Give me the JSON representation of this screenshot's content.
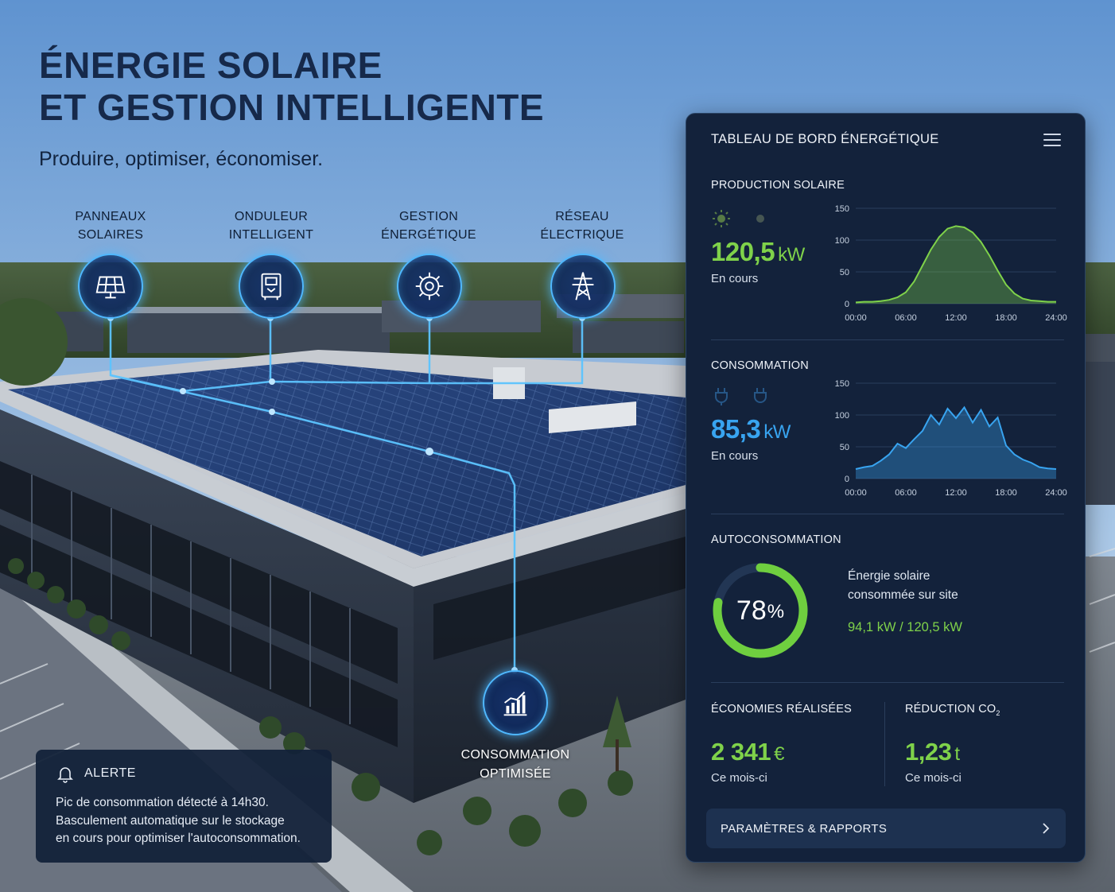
{
  "hero": {
    "title_line1": "ÉNERGIE SOLAIRE",
    "title_line2": "ET GESTION INTELLIGENTE",
    "subtitle": "Produire, optimiser, économiser."
  },
  "nodes": [
    {
      "line1": "PANNEAUX",
      "line2": "SOLAIRES",
      "icon": "solar-panel-icon"
    },
    {
      "line1": "ONDULEUR",
      "line2": "INTELLIGENT",
      "icon": "inverter-icon"
    },
    {
      "line1": "GESTION",
      "line2": "ÉNERGÉTIQUE",
      "icon": "energy-management-icon"
    },
    {
      "line1": "RÉSEAU",
      "line2": "ÉLECTRIQUE",
      "icon": "power-pylon-icon"
    }
  ],
  "optimized": {
    "line1": "CONSOMMATION",
    "line2": "OPTIMISÉE",
    "icon": "bar-chart-icon"
  },
  "alert": {
    "title": "ALERTE",
    "line1": "Pic de consommation détecté à 14h30.",
    "line2": "Basculement automatique sur le stockage",
    "line3": "en cours pour optimiser l'autoconsommation."
  },
  "dashboard": {
    "title": "TABLEAU DE BORD ÉNERGÉTIQUE",
    "production": {
      "label": "PRODUCTION SOLAIRE",
      "value": "120,5",
      "unit": "kW",
      "status": "En cours"
    },
    "consumption": {
      "label": "CONSOMMATION",
      "value": "85,3",
      "unit": "kW",
      "status": "En cours"
    },
    "self_consumption": {
      "label": "AUTOCONSOMMATION",
      "percent_value": "78",
      "percent_sign": "%",
      "fraction": 0.78,
      "desc_line1": "Énergie solaire",
      "desc_line2": "consommée sur site",
      "ratio": "94,1 kW / 120,5 kW"
    },
    "savings": {
      "label": "ÉCONOMIES RÉALISÉES",
      "value": "2 341",
      "unit": "€",
      "period": "Ce mois-ci"
    },
    "co2": {
      "label_prefix": "RÉDUCTION CO",
      "label_sub": "2",
      "value": "1,23",
      "unit": "t",
      "period": "Ce mois-ci"
    },
    "settings_button": "PARAMÈTRES & RAPPORTS"
  },
  "colors": {
    "green": "#7fd24a",
    "blue": "#38a4f0",
    "panel": "#13223b",
    "glow": "#4fb8ff"
  },
  "chart_data": [
    {
      "type": "area",
      "x": [
        "00:00",
        "01:00",
        "02:00",
        "03:00",
        "04:00",
        "05:00",
        "06:00",
        "07:00",
        "08:00",
        "09:00",
        "10:00",
        "11:00",
        "12:00",
        "13:00",
        "14:00",
        "15:00",
        "16:00",
        "17:00",
        "18:00",
        "19:00",
        "20:00",
        "21:00",
        "22:00",
        "23:00",
        "24:00"
      ],
      "x_ticks": [
        "00:00",
        "06:00",
        "12:00",
        "18:00",
        "24:00"
      ],
      "y_ticks": [
        "0",
        "50",
        "100",
        "150"
      ],
      "ylim": [
        0,
        150
      ],
      "series": [
        {
          "values": [
            2,
            3,
            3,
            4,
            6,
            10,
            18,
            35,
            60,
            85,
            105,
            118,
            122,
            120,
            112,
            97,
            76,
            52,
            30,
            16,
            8,
            5,
            4,
            3,
            3
          ]
        }
      ],
      "color": "#7fd24a"
    },
    {
      "type": "area",
      "x": [
        "00:00",
        "01:00",
        "02:00",
        "03:00",
        "04:00",
        "05:00",
        "06:00",
        "07:00",
        "08:00",
        "09:00",
        "10:00",
        "11:00",
        "12:00",
        "13:00",
        "14:00",
        "15:00",
        "16:00",
        "17:00",
        "18:00",
        "19:00",
        "20:00",
        "21:00",
        "22:00",
        "23:00",
        "24:00"
      ],
      "x_ticks": [
        "00:00",
        "06:00",
        "12:00",
        "18:00",
        "24:00"
      ],
      "y_ticks": [
        "0",
        "50",
        "100",
        "150"
      ],
      "ylim": [
        0,
        150
      ],
      "series": [
        {
          "values": [
            15,
            18,
            20,
            28,
            38,
            55,
            48,
            62,
            75,
            100,
            85,
            110,
            95,
            112,
            88,
            108,
            82,
            96,
            52,
            38,
            30,
            25,
            18,
            16,
            15
          ]
        }
      ],
      "color": "#38a4f0"
    }
  ]
}
